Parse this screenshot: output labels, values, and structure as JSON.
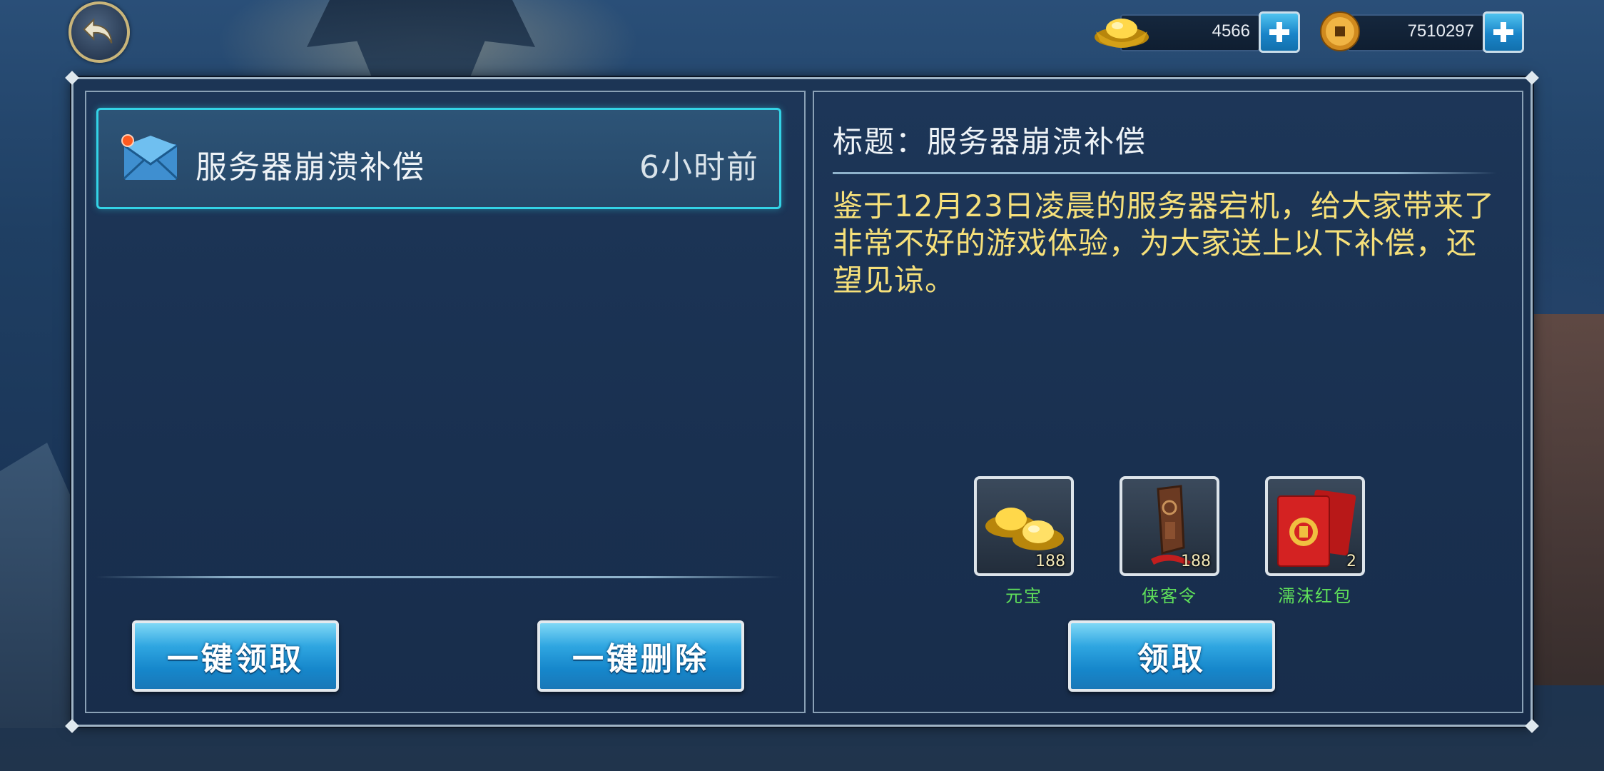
{
  "currencies": [
    {
      "name": "gold-ingot",
      "value": "4566"
    },
    {
      "name": "coin",
      "value": "7510297"
    }
  ],
  "mail_list": [
    {
      "title": "服务器崩溃补偿",
      "time": "6小时前",
      "unread": true
    }
  ],
  "left_buttons": {
    "claim_all": "一键领取",
    "delete_all": "一键删除"
  },
  "detail": {
    "title": "标题：服务器崩溃补偿",
    "body": "鉴于12月23日凌晨的服务器宕机，给大家带来了非常不好的游戏体验，为大家送上以下补偿，还望见谅。",
    "rewards": [
      {
        "name": "元宝",
        "count": "188",
        "icon": "gold-ingot-icon"
      },
      {
        "name": "侠客令",
        "count": "188",
        "icon": "token-icon"
      },
      {
        "name": "濡沫红包",
        "count": "2",
        "icon": "red-envelope-icon"
      }
    ],
    "claim_button": "领取"
  },
  "colors": {
    "accent_cyan": "#33d3e6",
    "body_text_yellow": "#f6e07a",
    "reward_name_green": "#5fe05a",
    "button_blue": "#1687cb"
  }
}
